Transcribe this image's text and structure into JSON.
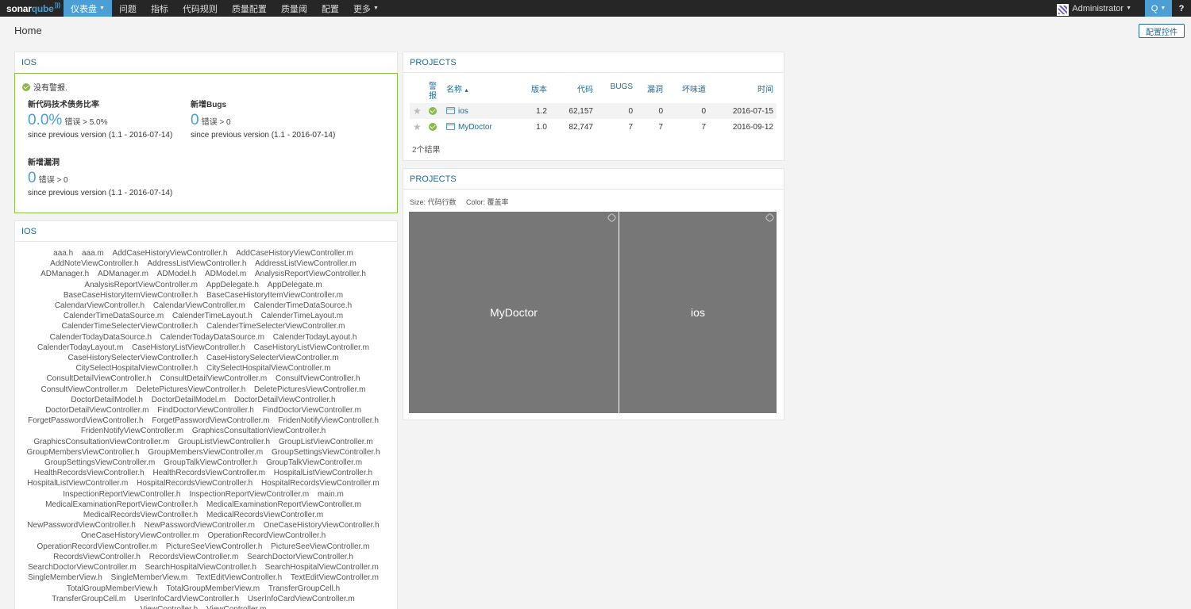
{
  "nav": {
    "logo_main": "sonar",
    "logo_accent": "qube",
    "items": [
      "仪表盘",
      "问题",
      "指标",
      "代码规则",
      "质量配置",
      "质量阈",
      "配置",
      "更多"
    ],
    "user": "Administrator",
    "search_glyph": "Q",
    "help_glyph": "?"
  },
  "header": {
    "title": "Home",
    "config_button": "配置控件"
  },
  "gate": {
    "title": "IOS",
    "status": "没有警报.",
    "conditions": [
      {
        "name": "新代码技术债务比率",
        "value": "0.0%",
        "threshold": "错误 > 5.0%",
        "since": "since previous version (1.1 - 2016-07-14)"
      },
      {
        "name": "新增Bugs",
        "value": "0",
        "threshold": "错误 > 0",
        "since": "since previous version (1.1 - 2016-07-14)"
      },
      {
        "name": "新增漏洞",
        "value": "0",
        "threshold": "错误 > 0",
        "since": "since previous version (1.1 - 2016-07-14)"
      }
    ]
  },
  "cloud": {
    "title": "IOS",
    "words": [
      "aaa.h",
      "aaa.m",
      "AddCaseHistoryViewController.h",
      "AddCaseHistoryViewController.m",
      "AddNoteViewController.h",
      "AddressListViewController.h",
      "AddressListViewController.m",
      "ADManager.h",
      "ADManager.m",
      "ADModel.h",
      "ADModel.m",
      "AnalysisReportViewController.h",
      "AnalysisReportViewController.m",
      "AppDelegate.h",
      "AppDelegate.m",
      "BaseCaseHistoryItemViewController.h",
      "BaseCaseHistoryItemViewController.m",
      "CalendarViewController.h",
      "CalendarViewController.m",
      "CalenderTimeDataSource.h",
      "CalenderTimeDataSource.m",
      "CalenderTimeLayout.h",
      "CalenderTimeLayout.m",
      "CalenderTimeSelecterViewController.h",
      "CalenderTimeSelecterViewController.m",
      "CalenderTodayDataSource.h",
      "CalenderTodayDataSource.m",
      "CalenderTodayLayout.h",
      "CalenderTodayLayout.m",
      "CaseHistoryListViewController.h",
      "CaseHistoryListViewController.m",
      "CaseHistorySelecterViewController.h",
      "CaseHistorySelecterViewController.m",
      "CitySelectHospitalViewController.h",
      "CitySelectHospitalViewController.m",
      "ConsultDetailViewController.h",
      "ConsultDetailViewController.m",
      "ConsultViewController.h",
      "ConsultViewController.m",
      "DeletePicturesViewController.h",
      "DeletePicturesViewController.m",
      "DoctorDetailModel.h",
      "DoctorDetailModel.m",
      "DoctorDetailViewController.h",
      "DoctorDetailViewController.m",
      "FindDoctorViewController.h",
      "FindDoctorViewController.m",
      "ForgetPasswordViewController.h",
      "ForgetPasswordViewController.m",
      "FridenNotifyViewController.h",
      "FridenNotifyViewController.m",
      "GraphicsConsultationViewController.h",
      "GraphicsConsultationViewController.m",
      "GroupListViewController.h",
      "GroupListViewController.m",
      "GroupMembersViewController.h",
      "GroupMembersViewController.m",
      "GroupSettingsViewController.h",
      "GroupSettingsViewController.m",
      "GroupTalkViewController.h",
      "GroupTalkViewController.m",
      "HealthRecordsViewController.h",
      "HealthRecordsViewController.m",
      "HospitalListViewController.h",
      "HospitalListViewController.m",
      "HospitalRecordsViewController.h",
      "HospitalRecordsViewController.m",
      "InspectionReportViewController.h",
      "InspectionReportViewController.m",
      "main.m",
      "MedicalExaminationReportViewController.h",
      "MedicalExaminationReportViewController.m",
      "MedicalRecordsViewController.h",
      "MedicalRecordsViewController.m",
      "NewPasswordViewController.h",
      "NewPasswordViewController.m",
      "OneCaseHistoryViewController.h",
      "OneCaseHistoryViewController.m",
      "OperationRecordViewController.h",
      "OperationRecordViewController.m",
      "PictureSeeViewController.h",
      "PictureSeeViewController.m",
      "RecordsViewController.h",
      "RecordsViewController.m",
      "SearchDoctorViewController.h",
      "SearchDoctorViewController.m",
      "SearchHospitalViewController.h",
      "SearchHospitalViewController.m",
      "SingleMemberView.h",
      "SingleMemberView.m",
      "TextEditViewController.h",
      "TextEditViewController.m",
      "TotalGroupMemberView.h",
      "TotalGroupMemberView.m",
      "TransferGroupCell.h",
      "TransferGroupCell.m",
      "UserInfoCardViewController.h",
      "UserInfoCardViewController.m",
      "ViewController.h",
      "ViewController.m"
    ]
  },
  "projects": {
    "title": "PROJECTS",
    "columns": {
      "alert_1": "警",
      "alert_2": "报",
      "name": "名称",
      "version": "版本",
      "code": "代码",
      "bugs": "BUGS",
      "vuln": "漏洞",
      "smell": "坏味道",
      "date": "时间"
    },
    "rows": [
      {
        "name": "ios",
        "version": "1.2",
        "code": "62,157",
        "bugs": "0",
        "vuln": "0",
        "smell": "0",
        "date": "2016-07-15"
      },
      {
        "name": "MyDoctor",
        "version": "1.0",
        "code": "82,747",
        "bugs": "7",
        "vuln": "7",
        "smell": "7",
        "date": "2016-09-12"
      }
    ],
    "results": "2个结果"
  },
  "treemap": {
    "title": "PROJECTS",
    "size_label": "Size: 代码行数",
    "color_label": "Color: 覆盖率",
    "tiles": [
      {
        "label": "MyDoctor",
        "value": 82747
      },
      {
        "label": "ios",
        "value": 62157
      }
    ],
    "tile_color": "#777777"
  }
}
